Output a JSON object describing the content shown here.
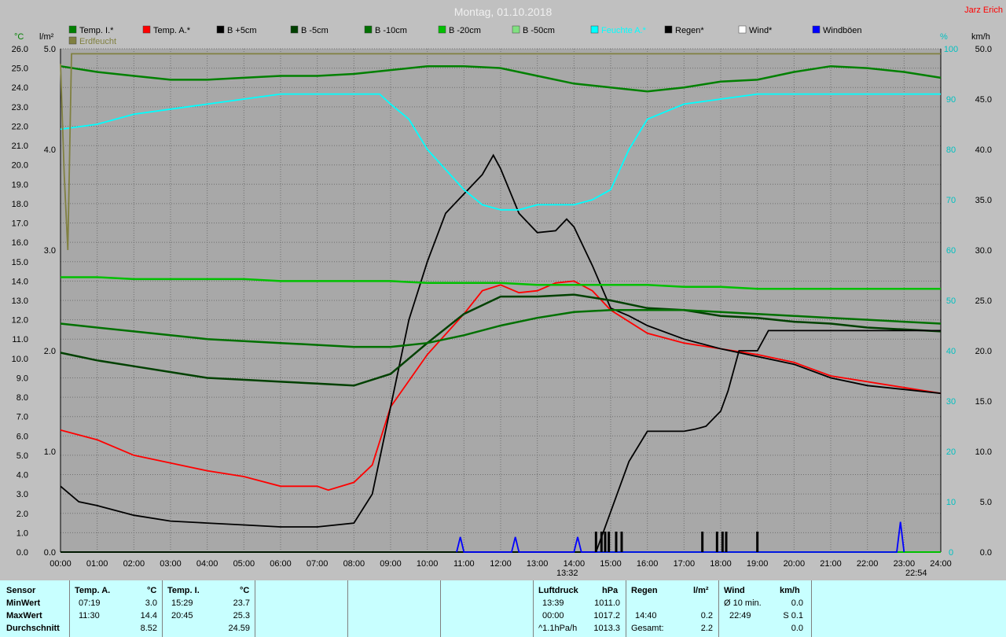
{
  "title": "Montag, 01.10.2018",
  "author": "Jarz Erich",
  "axis_units": {
    "left1": "°C",
    "left2": "l/m²",
    "right1": "%",
    "right2": "km/h"
  },
  "legend": [
    {
      "label": "Temp. I.*",
      "color": "#008000"
    },
    {
      "label": "Temp. A.*",
      "color": "#ff0000"
    },
    {
      "label": "B +5cm",
      "color": "#000000"
    },
    {
      "label": "B -5cm",
      "color": "#004000"
    },
    {
      "label": "B -10cm",
      "color": "#007000"
    },
    {
      "label": "B -20cm",
      "color": "#00c000"
    },
    {
      "label": "B -50cm",
      "color": "#80e080"
    },
    {
      "label": "Feuchte A.*",
      "color": "#00ffff"
    },
    {
      "label": "Regen*",
      "color": "#000000"
    },
    {
      "label": "Wind*",
      "color": "#ffffff"
    },
    {
      "label": "Windböen",
      "color": "#0000ff"
    },
    {
      "label": "Erdfeucht",
      "color": "#808040"
    }
  ],
  "markers": {
    "pressure_time": "13:32",
    "wind_time": "22:54"
  },
  "chart_data": {
    "type": "line",
    "x_axis": {
      "min": 0,
      "max": 24,
      "unit": "h",
      "ticks": [
        "00:00",
        "01:00",
        "02:00",
        "03:00",
        "04:00",
        "05:00",
        "06:00",
        "07:00",
        "08:00",
        "09:00",
        "10:00",
        "11:00",
        "12:00",
        "13:00",
        "14:00",
        "15:00",
        "16:00",
        "17:00",
        "18:00",
        "19:00",
        "20:00",
        "21:00",
        "22:00",
        "23:00",
        "24:00"
      ]
    },
    "y_temp": {
      "min": 0,
      "max": 26,
      "ticks": [
        "0.0",
        "1.0",
        "2.0",
        "3.0",
        "4.0",
        "5.0",
        "6.0",
        "7.0",
        "8.0",
        "9.0",
        "10.0",
        "11.0",
        "12.0",
        "13.0",
        "14.0",
        "15.0",
        "16.0",
        "17.0",
        "18.0",
        "19.0",
        "20.0",
        "21.0",
        "22.0",
        "23.0",
        "24.0",
        "25.0",
        "26.0"
      ]
    },
    "y_rain": {
      "min": 0,
      "max": 5,
      "ticks": [
        "0.0",
        "1.0",
        "2.0",
        "3.0",
        "4.0",
        "5.0"
      ]
    },
    "y_humidity": {
      "min": 0,
      "max": 100,
      "ticks": [
        "0",
        "10",
        "20",
        "30",
        "40",
        "50",
        "60",
        "70",
        "80",
        "90",
        "100"
      ]
    },
    "y_wind": {
      "min": 0,
      "max": 50,
      "ticks": [
        "0.0",
        "5.0",
        "10.0",
        "15.0",
        "20.0",
        "25.0",
        "30.0",
        "35.0",
        "40.0",
        "45.0",
        "50.0"
      ]
    },
    "series": [
      {
        "name": "Temp. I.*",
        "color": "#008000",
        "axis": "temp",
        "x": [
          0,
          1,
          2,
          3,
          4,
          5,
          6,
          7,
          8,
          9,
          10,
          11,
          12,
          13,
          14,
          15,
          16,
          17,
          18,
          19,
          20,
          21,
          22,
          23,
          24
        ],
        "y": [
          25.1,
          24.8,
          24.6,
          24.4,
          24.4,
          24.5,
          24.6,
          24.6,
          24.7,
          24.9,
          25.1,
          25.1,
          25.0,
          24.6,
          24.2,
          24.0,
          23.8,
          24.0,
          24.3,
          24.4,
          24.8,
          25.1,
          25.0,
          24.8,
          24.5
        ]
      },
      {
        "name": "Temp. A.*",
        "color": "#ff0000",
        "axis": "temp",
        "x": [
          0,
          1,
          2,
          3,
          4,
          5,
          6,
          7,
          7.3,
          8,
          8.5,
          9,
          10,
          11,
          11.5,
          12,
          12.5,
          13,
          13.5,
          14,
          14.5,
          15,
          16,
          17,
          18,
          19,
          20,
          21,
          22,
          23,
          24
        ],
        "y": [
          6.3,
          5.8,
          5.0,
          4.6,
          4.2,
          3.9,
          3.4,
          3.4,
          3.2,
          3.6,
          4.5,
          7.5,
          10.2,
          12.3,
          13.5,
          13.8,
          13.4,
          13.5,
          13.9,
          14.0,
          13.5,
          12.5,
          11.3,
          10.8,
          10.5,
          10.2,
          9.8,
          9.1,
          8.8,
          8.5,
          8.2
        ]
      },
      {
        "name": "B +5cm",
        "color": "#000000",
        "axis": "temp",
        "x": [
          0,
          0.5,
          1,
          2,
          3,
          4,
          5,
          6,
          7,
          8,
          8.5,
          9,
          9.5,
          10,
          10.5,
          11,
          11.5,
          11.8,
          12,
          12.5,
          13,
          13.5,
          13.8,
          14,
          14.5,
          15,
          15.5,
          16,
          17,
          18,
          19,
          20,
          21,
          22,
          23,
          24
        ],
        "y": [
          3.4,
          2.6,
          2.4,
          1.9,
          1.6,
          1.5,
          1.4,
          1.3,
          1.3,
          1.5,
          3.0,
          7.5,
          12.0,
          15.0,
          17.5,
          18.5,
          19.5,
          20.5,
          19.8,
          17.5,
          16.5,
          16.6,
          17.2,
          16.8,
          14.8,
          12.6,
          12.2,
          11.7,
          11.0,
          10.5,
          10.1,
          9.7,
          9.0,
          8.6,
          8.4,
          8.2
        ]
      },
      {
        "name": "B -5cm",
        "color": "#004000",
        "axis": "temp",
        "x": [
          0,
          1,
          2,
          3,
          4,
          5,
          6,
          7,
          8,
          9,
          10,
          11,
          12,
          13,
          14,
          15,
          16,
          17,
          18,
          19,
          20,
          21,
          22,
          23,
          24
        ],
        "y": [
          10.3,
          9.9,
          9.6,
          9.3,
          9.0,
          8.9,
          8.8,
          8.7,
          8.6,
          9.2,
          10.8,
          12.3,
          13.2,
          13.2,
          13.3,
          13.0,
          12.6,
          12.5,
          12.2,
          12.1,
          11.9,
          11.8,
          11.6,
          11.5,
          11.4
        ]
      },
      {
        "name": "B -10cm",
        "color": "#007000",
        "axis": "temp",
        "x": [
          0,
          1,
          2,
          3,
          4,
          5,
          6,
          7,
          8,
          9,
          10,
          11,
          12,
          13,
          14,
          15,
          16,
          17,
          18,
          19,
          20,
          21,
          22,
          23,
          24
        ],
        "y": [
          11.8,
          11.6,
          11.4,
          11.2,
          11.0,
          10.9,
          10.8,
          10.7,
          10.6,
          10.6,
          10.8,
          11.2,
          11.7,
          12.1,
          12.4,
          12.5,
          12.5,
          12.5,
          12.4,
          12.3,
          12.2,
          12.1,
          12.0,
          11.9,
          11.8
        ]
      },
      {
        "name": "B -20cm",
        "color": "#00c000",
        "axis": "temp",
        "x": [
          0,
          1,
          2,
          3,
          4,
          5,
          6,
          7,
          8,
          9,
          10,
          11,
          12,
          13,
          14,
          15,
          16,
          17,
          18,
          19,
          20,
          21,
          22,
          23,
          24
        ],
        "y": [
          14.2,
          14.2,
          14.1,
          14.1,
          14.1,
          14.1,
          14.0,
          14.0,
          14.0,
          14.0,
          13.9,
          13.9,
          13.9,
          13.8,
          13.8,
          13.8,
          13.8,
          13.7,
          13.7,
          13.6,
          13.6,
          13.6,
          13.6,
          13.6,
          13.6
        ]
      },
      {
        "name": "Feuchte A.*",
        "color": "#00ffff",
        "axis": "humidity",
        "x": [
          0,
          1,
          2,
          3,
          4,
          5,
          6,
          7,
          8,
          8.7,
          9,
          9.5,
          10,
          10.5,
          11,
          11.5,
          12,
          12.5,
          13,
          13.5,
          14,
          14.5,
          15,
          15.5,
          16,
          17,
          18,
          19,
          20,
          21,
          22,
          23,
          24
        ],
        "y": [
          84,
          85,
          87,
          88,
          89,
          90,
          91,
          91,
          91,
          91,
          89,
          86,
          80,
          76,
          72,
          69,
          68,
          68,
          69,
          69,
          69,
          70,
          72,
          80,
          86,
          89,
          90,
          91,
          91,
          91,
          91,
          91,
          91
        ]
      },
      {
        "name": "Erdfeucht",
        "color": "#808040",
        "axis": "humidity",
        "x": [
          0,
          0.1,
          0.2,
          0.3,
          1,
          2,
          3,
          4,
          5,
          6,
          7,
          8,
          9,
          10,
          11,
          12,
          13,
          14,
          15,
          16,
          17,
          18,
          19,
          20,
          21,
          22,
          23,
          24
        ],
        "y": [
          97,
          75,
          60,
          99,
          99,
          99,
          99,
          99,
          99,
          99,
          99,
          99,
          99,
          99,
          99,
          99,
          99,
          99,
          99,
          99,
          99,
          99,
          99,
          99,
          99,
          99,
          99,
          99
        ]
      },
      {
        "name": "Regen*",
        "color": "#000000",
        "axis": "rain",
        "x": [
          0,
          14.6,
          14.8,
          15.0,
          15.2,
          15.5,
          16,
          17,
          17.3,
          17.6,
          18,
          18.2,
          18.5,
          18.8,
          19,
          19.3,
          20,
          21,
          22,
          23,
          24
        ],
        "y": [
          0,
          0,
          0.2,
          0.4,
          0.6,
          0.9,
          1.2,
          1.2,
          1.22,
          1.25,
          1.4,
          1.6,
          2.0,
          2.0,
          2.0,
          2.2,
          2.2,
          2.2,
          2.2,
          2.2,
          2.2
        ]
      },
      {
        "name": "Windböen",
        "color": "#0000ff",
        "axis": "wind",
        "x": [
          10.8,
          10.9,
          11.0,
          12.3,
          12.4,
          12.5,
          14.0,
          14.1,
          14.2,
          22.8,
          22.9,
          23.0
        ],
        "y": [
          0,
          1.5,
          0,
          0,
          1.5,
          0,
          0,
          1.5,
          0,
          0,
          3.0,
          0
        ]
      }
    ],
    "rain_events": [
      14.6,
      14.75,
      14.85,
      14.95,
      15.15,
      15.3,
      17.5,
      17.9,
      18.05,
      18.15,
      19.0
    ]
  },
  "table": {
    "sensor": {
      "header": "Sensor",
      "rows": [
        "MinWert",
        "MaxWert",
        "Durchschnitt"
      ]
    },
    "temp_a": {
      "header": "Temp. A.",
      "unit": "°C",
      "rows": [
        [
          "07:19",
          "3.0"
        ],
        [
          "11:30",
          "14.4"
        ],
        [
          "",
          "8.52"
        ]
      ]
    },
    "temp_i": {
      "header": "Temp. I.",
      "unit": "°C",
      "rows": [
        [
          "15:29",
          "23.7"
        ],
        [
          "20:45",
          "25.3"
        ],
        [
          "",
          "24.59"
        ]
      ]
    },
    "pressure": {
      "header": "Luftdruck",
      "unit": "hPa",
      "rows": [
        [
          "13:39",
          "1011.0"
        ],
        [
          "00:00",
          "1017.2"
        ],
        [
          "^1.1hPa/h",
          "1013.3"
        ]
      ]
    },
    "rain": {
      "header": "Regen",
      "unit": "l/m²",
      "rows": [
        [
          "",
          ""
        ],
        [
          "14:40",
          "0.2"
        ],
        [
          "Gesamt:",
          "2.2"
        ]
      ]
    },
    "wind": {
      "header": "Wind",
      "unit": "km/h",
      "rows": [
        [
          "Ø 10 min.",
          "0.0"
        ],
        [
          "22:49",
          "S 0.1"
        ],
        [
          "",
          "0.0"
        ]
      ]
    }
  }
}
